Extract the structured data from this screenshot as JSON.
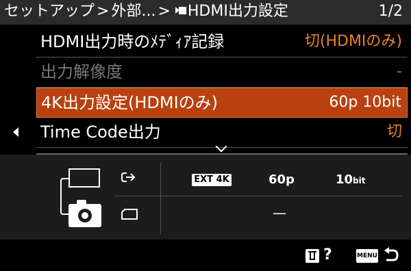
{
  "header": {
    "crumb1": "セットアップ",
    "sep": ">",
    "crumb2": "外部...",
    "crumb3": "HDMI出力設定",
    "page": "1/2"
  },
  "menu": {
    "items": [
      {
        "label": "HDMI出力時のﾒﾃﾞｨｱ記録",
        "value": "切(HDMIのみ)"
      },
      {
        "label": "出力解像度",
        "value": "-"
      },
      {
        "label": "4K出力設定(HDMIのみ)",
        "value": "60p 10bit"
      },
      {
        "label": "Time Code出力",
        "value": "切"
      }
    ]
  },
  "info": {
    "ext_badge": "EXT 4K",
    "fps": "60p",
    "bit_num": "10",
    "bit_unit": "bit",
    "card_dash": "—"
  },
  "footer": {
    "help": "?",
    "menu_btn": "MENU"
  },
  "colors": {
    "accent": "#e7822e",
    "selected": "#b8410f"
  }
}
